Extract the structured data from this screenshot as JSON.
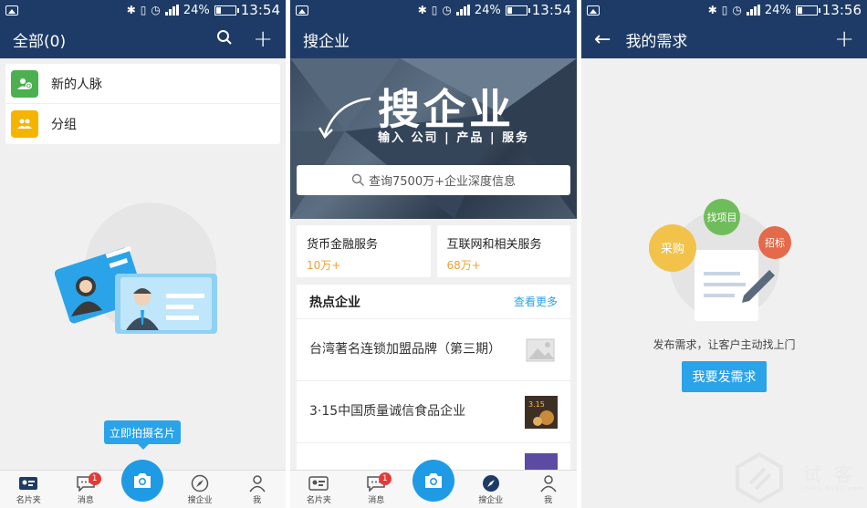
{
  "status": {
    "screen1_time": "13:54",
    "screen2_time": "13:54",
    "screen3_time": "13:56",
    "battery": "24%",
    "net": "4G"
  },
  "screen1": {
    "title": "全部(0)",
    "list": [
      {
        "label": "新的人脉",
        "color": "#4caf50"
      },
      {
        "label": "分组",
        "color": "#f5b400"
      }
    ],
    "shoot_button": "立即拍摄名片"
  },
  "screen2": {
    "title": "搜企业",
    "banner_title": "搜企业",
    "banner_subtitle": "输入 公司 | 产品 | 服务",
    "search_placeholder": "查询7500万+企业深度信息",
    "services": [
      {
        "name": "货币金融服务",
        "count": "10万+"
      },
      {
        "name": "互联网和相关服务",
        "count": "68万+"
      }
    ],
    "hot_title": "热点企业",
    "hot_more": "查看更多",
    "hot_items": [
      {
        "text": "台湾著名连锁加盟品牌（第三期）"
      },
      {
        "text": "3·15中国质量诚信食品企业",
        "thumb_text": "3.15"
      }
    ]
  },
  "screen3": {
    "title": "我的需求",
    "bubbles": [
      "采购",
      "找项目",
      "招标"
    ],
    "description": "发布需求，让客户主动找上门",
    "button": "我要发需求"
  },
  "tabbar": {
    "tabs": [
      "名片夹",
      "消息",
      "搜企业",
      "我"
    ],
    "message_badge": "1"
  },
  "watermark": {
    "text": "试客",
    "url": "shike.6768.com"
  },
  "colors": {
    "header": "#1d3b66",
    "accent": "#2aa3e8",
    "camera": "#1e9be4",
    "badge": "#e53935",
    "orange": "#f0a030"
  }
}
